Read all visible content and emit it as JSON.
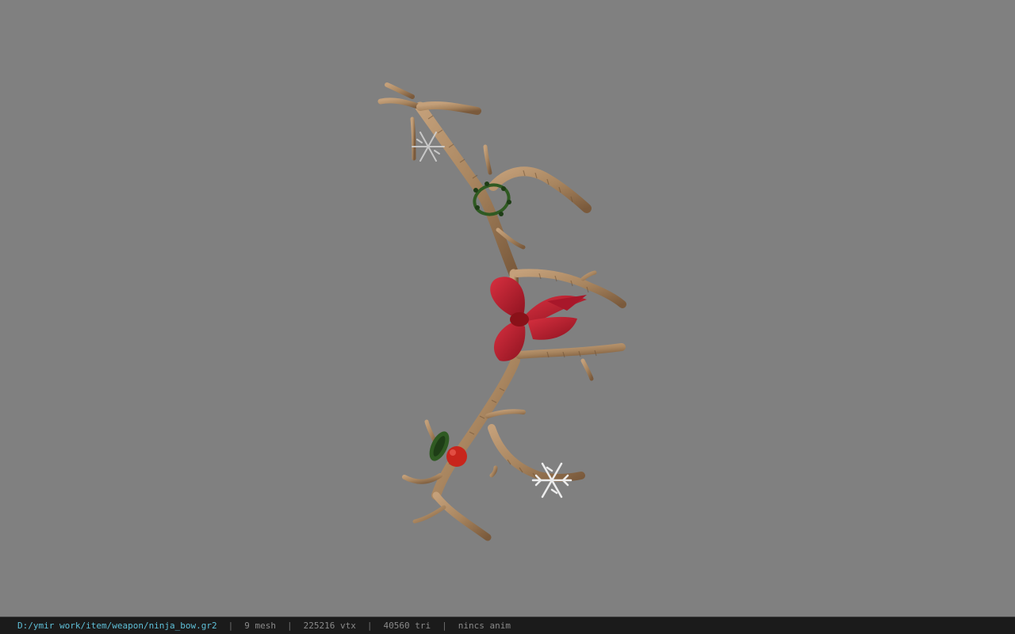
{
  "viewer": {
    "model_name": "ninja_bow",
    "background_color": "#808080"
  },
  "statusbar": {
    "file_path": "D:/ymir work/item/weapon/ninja_bow.gr2",
    "separator": "|",
    "mesh_count": "9 mesh",
    "vertex_count": "225216 vtx",
    "triangle_count": "40560 tri",
    "animation": "nincs anim"
  },
  "colors": {
    "branch": "#a8855f",
    "branch_dark": "#6e5236",
    "ribbon": "#c0202c",
    "ribbon_dark": "#8a1119",
    "wreath": "#2f5a22",
    "ornament": "#c8251c",
    "snowflake": "#e6e6e6",
    "path_text": "#5fc0d8"
  }
}
